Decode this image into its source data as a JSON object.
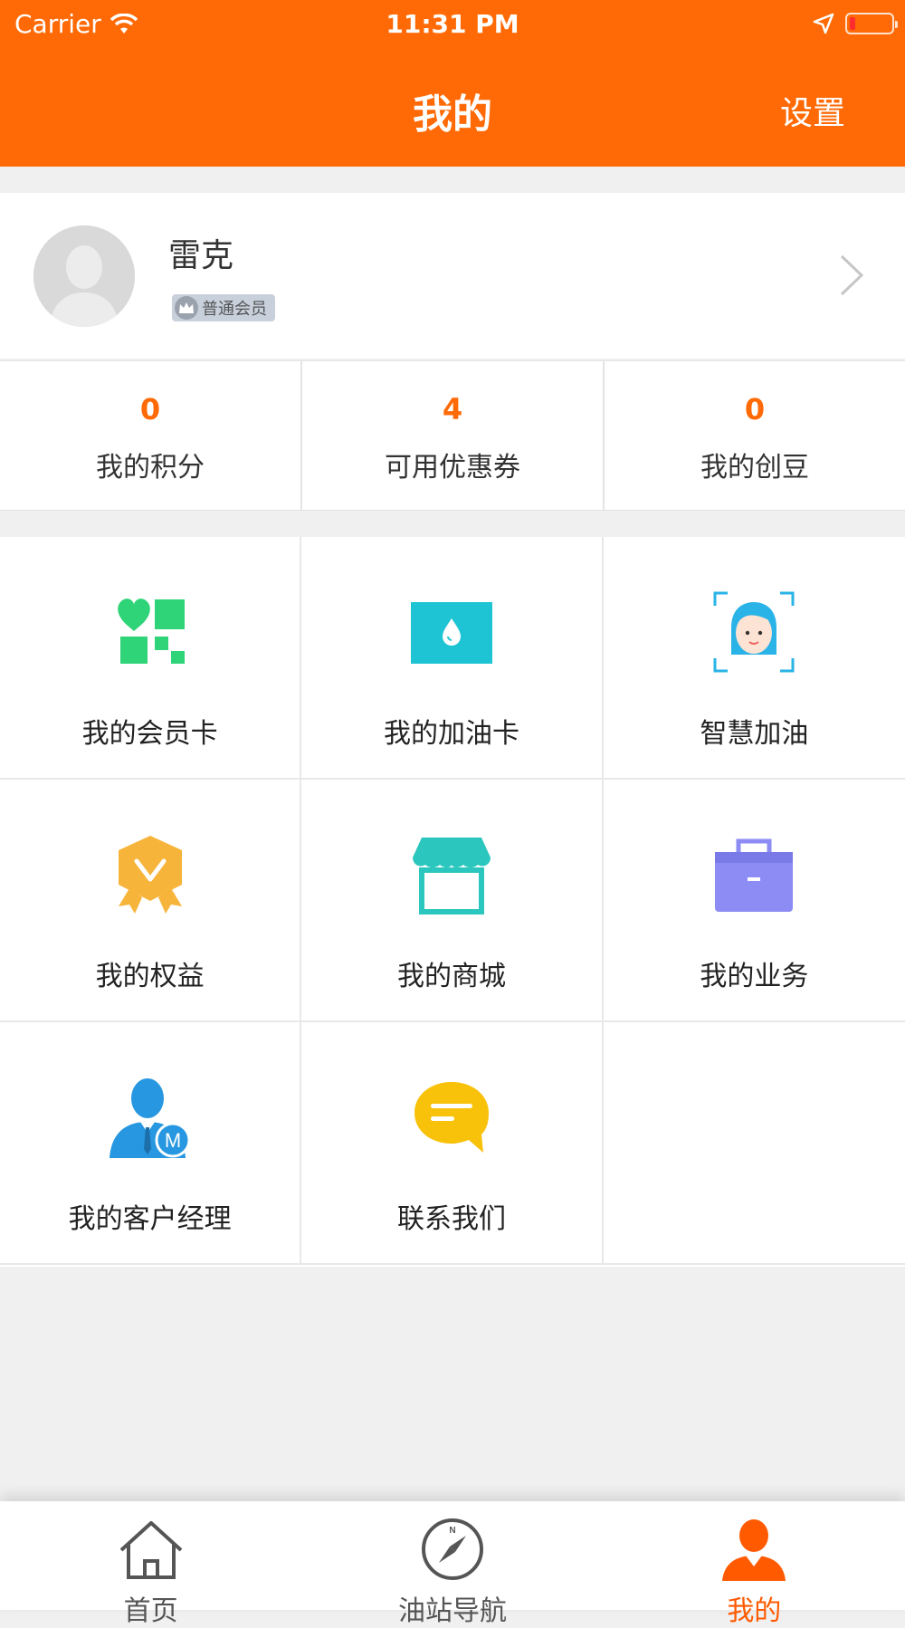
{
  "status_bar": {
    "carrier": "Carrier",
    "time": "11:31 PM"
  },
  "nav": {
    "title": "我的",
    "right_action": "设置"
  },
  "profile": {
    "name": "雷克",
    "badge": "普通会员"
  },
  "stats": [
    {
      "value": "0",
      "label": "我的积分"
    },
    {
      "value": "4",
      "label": "可用优惠券"
    },
    {
      "value": "0",
      "label": "我的创豆"
    }
  ],
  "menu": [
    {
      "label": "我的会员卡",
      "icon": "member-card-icon"
    },
    {
      "label": "我的加油卡",
      "icon": "fuel-card-icon"
    },
    {
      "label": "智慧加油",
      "icon": "face-scan-icon"
    },
    {
      "label": "我的权益",
      "icon": "badge-icon"
    },
    {
      "label": "我的商城",
      "icon": "shop-icon"
    },
    {
      "label": "我的业务",
      "icon": "briefcase-icon"
    },
    {
      "label": "我的客户经理",
      "icon": "manager-icon"
    },
    {
      "label": "联系我们",
      "icon": "chat-icon"
    }
  ],
  "tabbar": [
    {
      "label": "首页",
      "icon": "home-icon",
      "active": false
    },
    {
      "label": "油站导航",
      "icon": "compass-icon",
      "active": false
    },
    {
      "label": "我的",
      "icon": "person-icon",
      "active": true
    }
  ],
  "colors": {
    "primary": "#ff6a06",
    "tab_active": "#ff5a00",
    "background": "#f0f0f0"
  }
}
